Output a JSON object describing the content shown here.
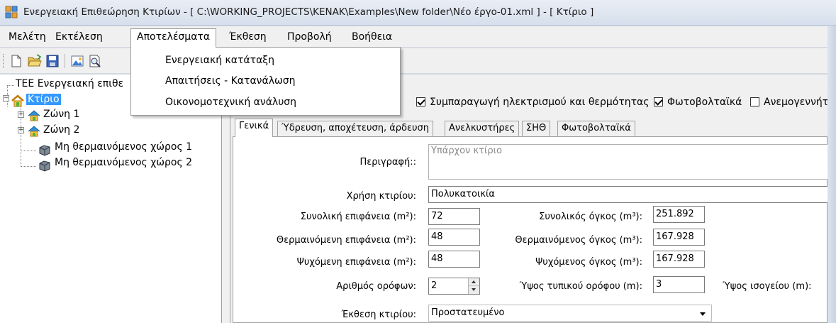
{
  "window": {
    "title": "Ενεργειακή Επιθεώρηση Κτιρίων - [ C:\\WORKING_PROJECTS\\KENAK\\Examples\\New folder\\Νέο έργο-01.xml ] - [ Κτίριο ]",
    "app_icon": "app-grid-icon"
  },
  "menubar": {
    "items": [
      {
        "label": "Μελέτη"
      },
      {
        "label": "Εκτέλεση"
      },
      {
        "label": "Αποτελέσματα",
        "active": true
      },
      {
        "label": "Έκθεση"
      },
      {
        "label": "Προβολή"
      },
      {
        "label": "Βοήθεια"
      }
    ]
  },
  "dropdown": {
    "items": [
      {
        "label": "Ενεργειακή κατάταξη"
      },
      {
        "label": "Απαιτήσεις - Κατανάλωση"
      },
      {
        "label": "Οικονομοτεχνική ανάλυση"
      }
    ]
  },
  "toolbar": {
    "buttons": [
      "new-file-icon",
      "open-folder-icon",
      "save-icon",
      "image-icon",
      "print-preview-icon"
    ]
  },
  "tree": {
    "root": "TEE Ενεργειακή επιθε",
    "building": "Κτίριο",
    "zones": [
      "Ζώνη 1",
      "Ζώνη 2"
    ],
    "unheated": [
      "Μη θερμαινόμενος χώρος 1",
      "Μη θερμαινόμενος χώρος 2"
    ]
  },
  "checkboxes": [
    {
      "label": "Συμπαραγωγή ηλεκτρισμού και θερμότητας",
      "checked": true
    },
    {
      "label": "Φωτοβολταϊκά",
      "checked": true
    },
    {
      "label": "Ανεμογεννήτρ",
      "checked": false
    }
  ],
  "tabs": [
    {
      "label": "Γενικά",
      "active": true
    },
    {
      "label": "Ύδρευση, αποχέτευση, άρδευση"
    },
    {
      "label": "Ανελκυστήρες"
    },
    {
      "label": "ΣΗΘ"
    },
    {
      "label": "Φωτοβολταϊκά"
    }
  ],
  "form": {
    "description_label": "Περιγραφή::",
    "description_value": "Υπάρχον κτίριο",
    "use_label": "Χρήση κτιρίου:",
    "use_value": "Πολυκατοικία",
    "total_area_label": "Συνολική επιφάνεια (m²):",
    "total_area_value": "72",
    "heated_area_label": "Θερμαινόμενη επιφάνεια (m²):",
    "heated_area_value": "48",
    "cooled_area_label": "Ψυχόμενη επιφάνεια (m²):",
    "cooled_area_value": "48",
    "floors_label": "Αριθμός ορόφων:",
    "floors_value": "2",
    "total_volume_label": "Συνολικός όγκος (m³):",
    "total_volume_value": "251.892",
    "heated_volume_label": "Θερμαινόμενος όγκος (m³):",
    "heated_volume_value": "167.928",
    "cooled_volume_label": "Ψυχόμενος όγκος (m³):",
    "cooled_volume_value": "167.928",
    "floor_height_label": "Ύψος τυπικού ορόφου (m):",
    "floor_height_value": "3",
    "ground_height_label": "Ύψος ισογείου (m):",
    "exposure_label": "Έκθεση κτιρίου:",
    "exposure_value": "Προστατευμένο"
  },
  "colors": {
    "selection": "#3399ff",
    "chrome": "#f0f0f0",
    "titlebar": "#d6dfec"
  }
}
